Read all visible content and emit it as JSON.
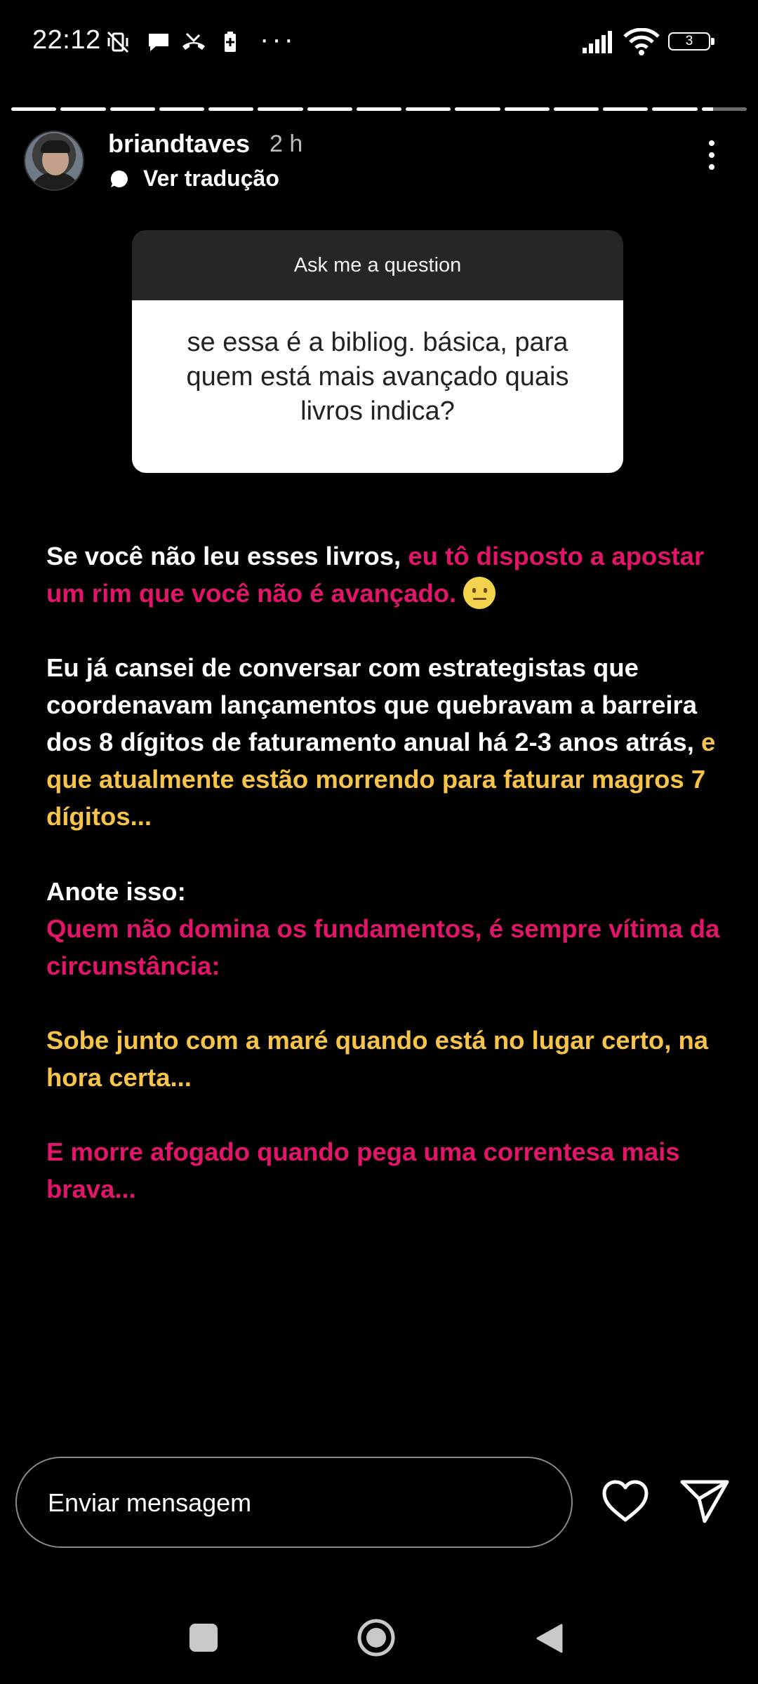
{
  "status_bar": {
    "time": "22:12",
    "battery_level": "3",
    "icons": [
      "mute-vibrate-icon",
      "chat-bubble-icon",
      "missed-call-icon",
      "battery-saver-icon",
      "more-dots-icon",
      "signal-icon",
      "wifi-icon",
      "battery-icon"
    ],
    "more_glyph": "···"
  },
  "story": {
    "segments_total": 15,
    "current_segment": 15,
    "current_segment_progress": 0.25,
    "user": {
      "username": "briandtaves",
      "age": "2 h"
    },
    "translate_label": "Ver tradução"
  },
  "question_card": {
    "header": "Ask me a question",
    "question": "se essa é a bibliog. básica, para quem está mais avançado quais livros indica?"
  },
  "story_text": {
    "p1_white": "Se você não leu esses livros, ",
    "p1_pink": "eu tô disposto a apostar um rim que você não é avançado.",
    "p2_white": "Eu já cansei de conversar com estrategistas que coordenavam lançamentos que quebravam a barreira dos 8 dígitos de faturamento anual há 2-3 anos atrás, ",
    "p2_yellow": "e que atualmente estão morrendo para faturar magros 7 dígitos...",
    "p3_white": "Anote isso:",
    "p3_pink": "Quem não domina os fundamentos, é sempre vítima da circunstância:",
    "p4_yellow": "Sobe junto com a maré quando está no lugar certo, na hora certa...",
    "p5_pink": "E morre afogado quando pega uma correntesa mais brava..."
  },
  "colors": {
    "accent_pink": "#e3156a",
    "accent_yellow": "#f7c348",
    "background": "#000000"
  },
  "reply_bar": {
    "placeholder": "Enviar mensagem"
  }
}
